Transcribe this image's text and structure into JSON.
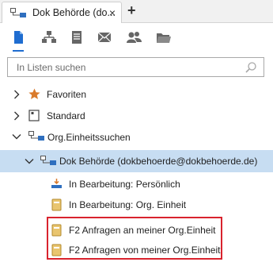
{
  "tab": {
    "title": "Dok Behörde (do...",
    "close": "×",
    "new_tab": "+"
  },
  "toolbar": {
    "icons": [
      "document-icon",
      "org-tree-icon",
      "list-icon",
      "mail-icon",
      "users-icon",
      "folder-icon"
    ],
    "active": "document-icon",
    "accent": "#1f6dd0"
  },
  "search": {
    "placeholder": "In Listen suchen"
  },
  "tree": {
    "favoriten": "Favoriten",
    "standard": "Standard",
    "org_suchen": "Org.Einheitssuchen",
    "dok_behoerde": "Dok Behörde (dokbehoerde@dokbehoerde.de)",
    "in_bearbeitung_persoenlich": "In Bearbeitung: Persönlich",
    "in_bearbeitung_org": "In Bearbeitung: Org. Einheit",
    "f2_anfragen_an": "F2 Anfragen an meiner Org.Einheit",
    "f2_anfragen_von": "F2 Anfragen von meiner Org.Einheit"
  },
  "colors": {
    "selection": "#c7ddf2",
    "highlight_box": "#d9232e",
    "star": "#d97a2b"
  }
}
